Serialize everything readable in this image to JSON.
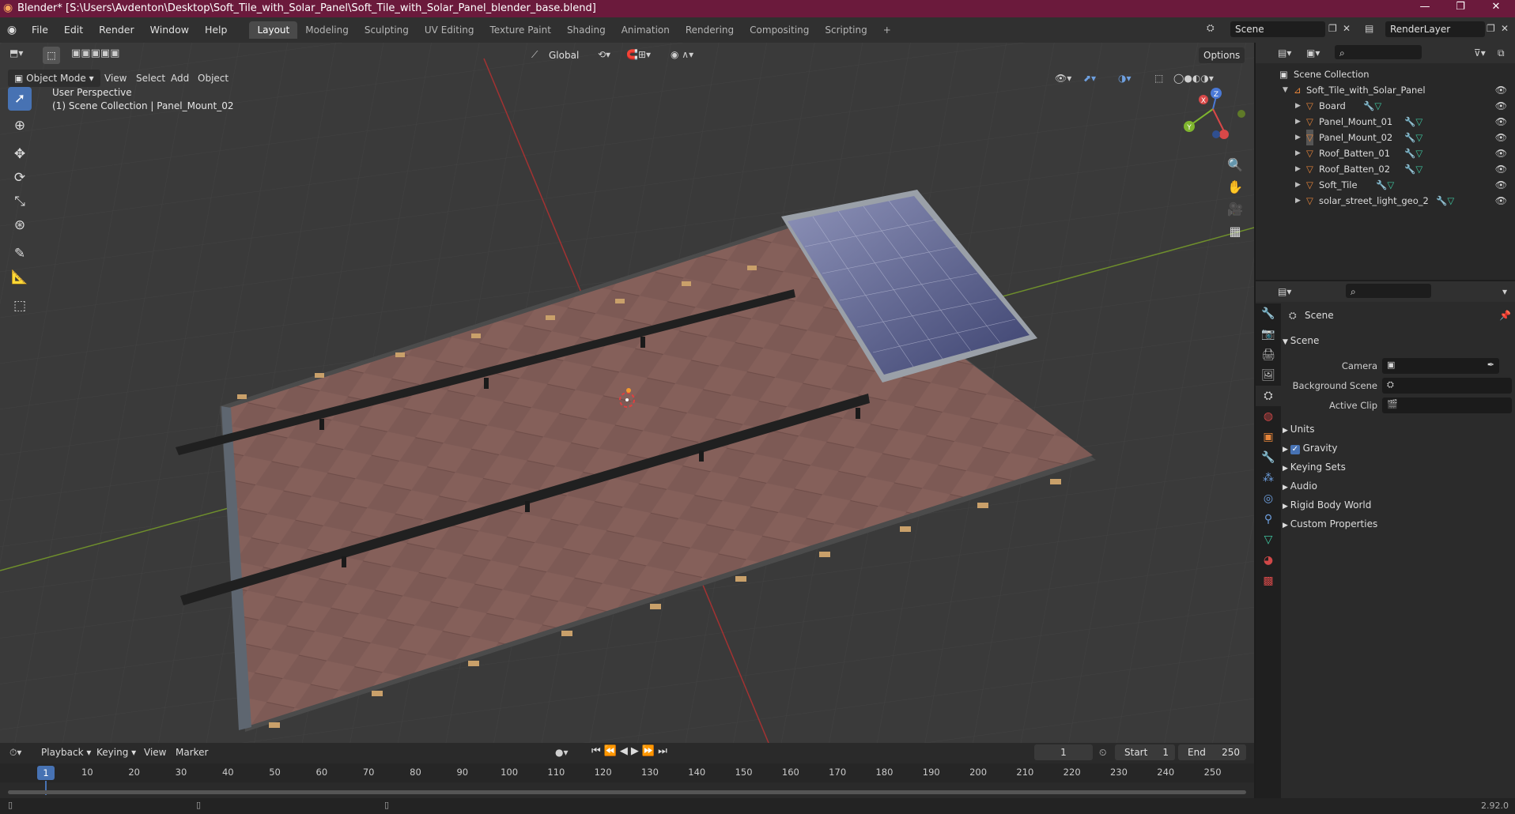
{
  "titlebar": {
    "title": "Blender* [S:\\Users\\Avdenton\\Desktop\\Soft_Tile_with_Solar_Panel\\Soft_Tile_with_Solar_Panel_blender_base.blend]",
    "minimize": "—",
    "maximize": "❐",
    "close": "✕"
  },
  "menu": {
    "items": [
      "File",
      "Edit",
      "Render",
      "Window",
      "Help"
    ],
    "workspaces": [
      "Layout",
      "Modeling",
      "Sculpting",
      "UV Editing",
      "Texture Paint",
      "Shading",
      "Animation",
      "Rendering",
      "Compositing",
      "Scripting"
    ],
    "active_workspace": "Layout",
    "add_tab": "+",
    "scene": "Scene",
    "render_layer": "RenderLayer"
  },
  "viewport": {
    "mode": "Object Mode",
    "menus": [
      "View",
      "Select",
      "Add",
      "Object"
    ],
    "transform_orientation": "Global",
    "options": "Options",
    "overlay_title": "User Perspective",
    "overlay_subtitle": "(1) Scene Collection | Panel_Mount_02",
    "gizmo": {
      "x": "X",
      "y": "Y",
      "z": "Z"
    }
  },
  "tools": [
    "select-box",
    "cursor",
    "move",
    "rotate",
    "scale",
    "transform",
    "annotate",
    "measure",
    "add-cube"
  ],
  "outliner": {
    "root": "Scene Collection",
    "collection": "Soft_Tile_with_Solar_Panel",
    "objects": [
      "Board",
      "Panel_Mount_01",
      "Panel_Mount_02",
      "Roof_Batten_01",
      "Roof_Batten_02",
      "Soft_Tile",
      "solar_street_light_geo_2"
    ]
  },
  "properties": {
    "header": "Scene",
    "section": "Scene",
    "fields": [
      {
        "label": "Camera"
      },
      {
        "label": "Background Scene"
      },
      {
        "label": "Active Clip"
      }
    ],
    "panels": [
      "Units",
      "Gravity",
      "Keying Sets",
      "Audio",
      "Rigid Body World",
      "Custom Properties"
    ],
    "gravity_checked": true
  },
  "timeline": {
    "menus": [
      "Playback",
      "Keying",
      "View",
      "Marker"
    ],
    "current_frame": "1",
    "start_label": "Start",
    "start": "1",
    "end_label": "End",
    "end": "250",
    "ticks": [
      "1",
      "10",
      "20",
      "30",
      "40",
      "50",
      "60",
      "70",
      "80",
      "90",
      "100",
      "110",
      "120",
      "130",
      "140",
      "150",
      "160",
      "170",
      "180",
      "190",
      "200",
      "210",
      "220",
      "230",
      "240",
      "250"
    ]
  },
  "status": {
    "version": "2.92.0"
  },
  "colors": {
    "title": "#6b1a3c",
    "accent": "#4772b3",
    "object": "#e6853a",
    "mesh": "#3fc6a0"
  }
}
